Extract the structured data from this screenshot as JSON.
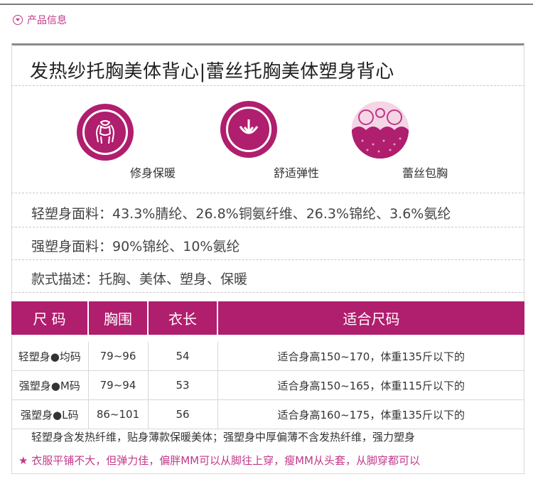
{
  "section_header": "产品信息",
  "product_title": "发热纱托胸美体背心|蕾丝托胸美体塑身背心",
  "features": [
    {
      "icon": "body-shape-icon",
      "label": "修身保暖"
    },
    {
      "icon": "elastic-arrow-icon",
      "label": "舒适弹性"
    },
    {
      "icon": "lace-bra-icon",
      "label": "蕾丝包胸"
    }
  ],
  "info": [
    "轻塑身面料：43.3%腈纶、26.8%铜氨纤维、26.3%锦纶、3.6%氨纶",
    "强塑身面料：90%锦纶、10%氨纶",
    "款式描述：托胸、美体、塑身、保暖"
  ],
  "size_table": {
    "headers": [
      "尺  码",
      "胸围",
      "衣长",
      "适合尺码"
    ],
    "rows": [
      [
        "轻塑身●均码",
        "79~96",
        "54",
        "适合身高150~170，体重135斤以下的"
      ],
      [
        "强塑身●M码",
        "79~94",
        "53",
        "适合身高150~165，体重115斤以下的"
      ],
      [
        "强塑身●L码",
        "86~101",
        "56",
        "适合身高160~175，体重135斤以下的"
      ]
    ]
  },
  "note_main": "轻塑身含发热纤维，贴身薄款保暖美体；强塑身中厚偏薄不含发热纤维，强力塑身",
  "note_star": "★ 衣服平铺不大，但弹力佳，偏胖MM可以从脚往上穿，瘦MM从头套，从脚穿都可以",
  "colors": {
    "accent": "#b01e6e",
    "accent_text": "#c2378a"
  }
}
